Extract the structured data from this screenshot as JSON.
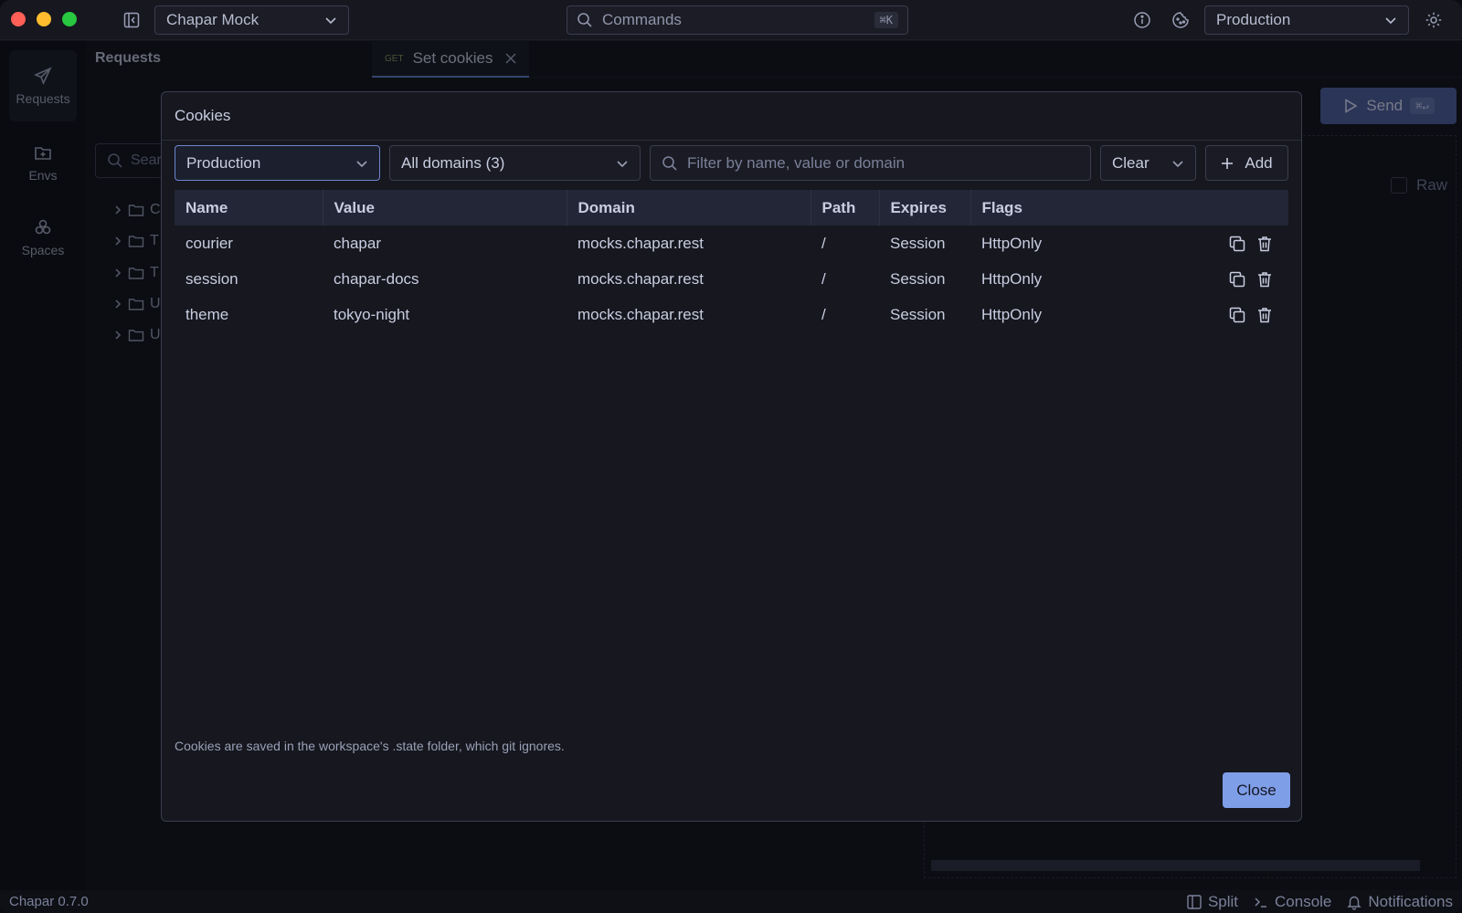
{
  "titlebar": {
    "workspace": "Chapar Mock",
    "command_placeholder": "Commands",
    "command_shortcut": "⌘K",
    "environment": "Production"
  },
  "rail": {
    "items": [
      {
        "label": "Requests",
        "icon": "send-icon"
      },
      {
        "label": "Envs",
        "icon": "folder-plus-icon"
      },
      {
        "label": "Spaces",
        "icon": "spaces-icon"
      }
    ]
  },
  "sidebar": {
    "title": "Requests",
    "search_placeholder": "Sear",
    "tree": [
      "C",
      "T",
      "T",
      "U",
      "U"
    ]
  },
  "tabs": [
    {
      "method": "GET",
      "label": "Set cookies"
    }
  ],
  "send": {
    "label": "Send",
    "shortcut": "⌘↵"
  },
  "raw_label": "Raw",
  "modal": {
    "title": "Cookies",
    "environment_select": "Production",
    "domain_select": "All domains (3)",
    "filter_placeholder": "Filter by name, value or domain",
    "clear_label": "Clear",
    "add_label": "Add",
    "columns": [
      "Name",
      "Value",
      "Domain",
      "Path",
      "Expires",
      "Flags"
    ],
    "rows": [
      {
        "name": "courier",
        "value": "chapar",
        "domain": "mocks.chapar.rest",
        "path": "/",
        "expires": "Session",
        "flags": "HttpOnly"
      },
      {
        "name": "session",
        "value": "chapar-docs",
        "domain": "mocks.chapar.rest",
        "path": "/",
        "expires": "Session",
        "flags": "HttpOnly"
      },
      {
        "name": "theme",
        "value": "tokyo-night",
        "domain": "mocks.chapar.rest",
        "path": "/",
        "expires": "Session",
        "flags": "HttpOnly"
      }
    ],
    "footnote": "Cookies are saved in the workspace's .state folder, which git ignores.",
    "close_label": "Close"
  },
  "statusbar": {
    "version": "Chapar 0.7.0",
    "split": "Split",
    "console": "Console",
    "notifications": "Notifications"
  },
  "colors": {
    "accent": "#7f9ee8",
    "send_button": "#4a5b95",
    "background": "#12131a"
  }
}
